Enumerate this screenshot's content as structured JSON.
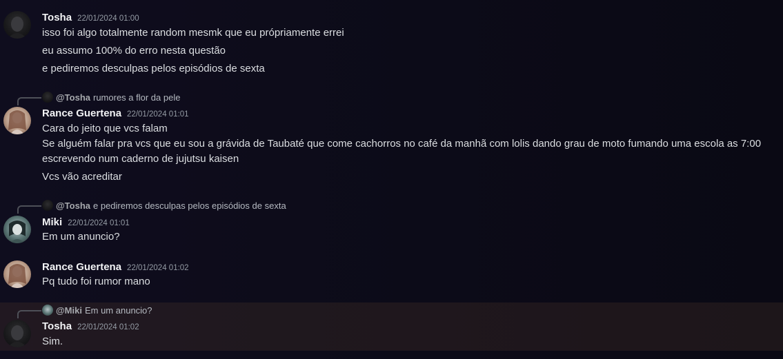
{
  "messages": [
    {
      "author": "Tosha",
      "timestamp": "22/01/2024 01:00",
      "lines": [
        "isso foi algo totalmente random mesmk que eu própriamente errei",
        "eu assumo 100% do erro nesta questão",
        "e pediremos desculpas pelos episódios de sexta"
      ]
    },
    {
      "reply": {
        "user": "@Tosha",
        "text": "rumores a flor da pele"
      },
      "author": "Rance Guertena",
      "timestamp": "22/01/2024 01:01",
      "lines": [
        "Cara do jeito que vcs falam",
        "Se alguém falar pra vcs que eu sou a grávida de Taubaté que come cachorros no café da manhã com lolis dando grau de moto fumando uma escola as 7:00",
        "escrevendo num caderno de jujutsu kaisen",
        "Vcs vão acreditar"
      ]
    },
    {
      "reply": {
        "user": "@Tosha",
        "text": "e pediremos desculpas pelos episódios de sexta"
      },
      "author": "Miki",
      "timestamp": "22/01/2024 01:01",
      "lines": [
        "Em um anuncio?"
      ]
    },
    {
      "author": "Rance Guertena",
      "timestamp": "22/01/2024 01:02",
      "lines": [
        "Pq tudo foi rumor mano"
      ]
    },
    {
      "reply": {
        "user": "@Miki",
        "text": "Em um anuncio?"
      },
      "author": "Tosha",
      "timestamp": "22/01/2024 01:02",
      "lines": [
        "Sim."
      ]
    }
  ],
  "colors": {
    "background": "#0d0c1a",
    "username": "#f2f3f5",
    "message_text": "#dbdee1",
    "timestamp": "#949ba4",
    "highlight": "#2a211e"
  }
}
